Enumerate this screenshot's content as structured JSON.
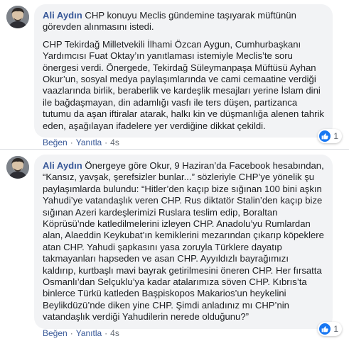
{
  "comments": [
    {
      "author": "Ali Aydın",
      "paragraph1": " CHP konuyu Meclis gündemine taşıyarak müftünün görevden alınmasını istedi.",
      "paragraph2": "CHP Tekirdağ Milletvekili İlhami Özcan Aygun, Cumhurbaşkanı Yardımcısı Fuat Oktay’ın yanıtlaması istemiyle Meclis’te soru önergesi verdi. Önergede, Tekirdağ Süleymanpaşa Müftüsü Ayhan Okur’un, sosyal medya paylaşımlarında ve cami cemaatine verdiği vaazlarında birlik, beraberlik ve kardeşlik mesajları yerine İslam dini ile bağdaşmayan, din adamlığı vasfı ile ters düşen, partizanca tutumu da aşan iftiralar atarak, halkı kin ve düşmanlığa alenen tahrik eden, aşağılayan ifadelere yer verdiğine dikkat çekildi.",
      "like_label": "Beğen",
      "reply_label": "Yanıtla",
      "time": "4s",
      "reaction_count": "1"
    },
    {
      "author": "Ali Aydın",
      "paragraph1": " Önergeye göre Okur, 9 Haziran’da Facebook hesabından, “Kansız, yavşak, şerefsizler bunlar...” sözleriyle CHP’ye yönelik şu paylaşımlarda bulundu: “Hitler’den kaçıp bize sığınan 100 bini aşkın Yahudi’ye vatandaşlık veren CHP. Rus diktatör Stalin’den kaçıp bize sığınan Azeri kardeşlerimizi Ruslara teslim edip, Boraltan Köprüsü’nde katledilmelerini izleyen CHP. Anadolu’yu Rumlardan alan, Alaeddin Keykubat’ın kemiklerini mezarından çıkarıp köpeklere atan CHP. Yahudi şapkasını yasa zoruyla Türklere dayatıp takmayanları hapseden ve asan CHP. Ayyıldızlı bayrağımızı kaldırıp, kurtbaşlı mavi bayrak getirilmesini öneren CHP. Her fırsatta Osmanlı’dan Selçuklu’ya kadar atalarımıza söven CHP. Kıbrıs’ta binlerce Türkü katleden Başpiskopos Makarios’un heykelini Beylikdüzü’nde diken yine CHP. Şimdi anladınız mı CHP’nin vatandaşlık verdiği Yahudilerin nerede olduğunu?”",
      "like_label": "Beğen",
      "reply_label": "Yanıtla",
      "time": "4s",
      "reaction_count": "1"
    }
  ],
  "colors": {
    "author": "#385898",
    "bubble": "#f2f3f5",
    "like_blue": "#1877f2",
    "meta": "#606770"
  },
  "icons": {
    "avatar": "avatar-icon",
    "reaction": "thumbs-up-icon"
  }
}
